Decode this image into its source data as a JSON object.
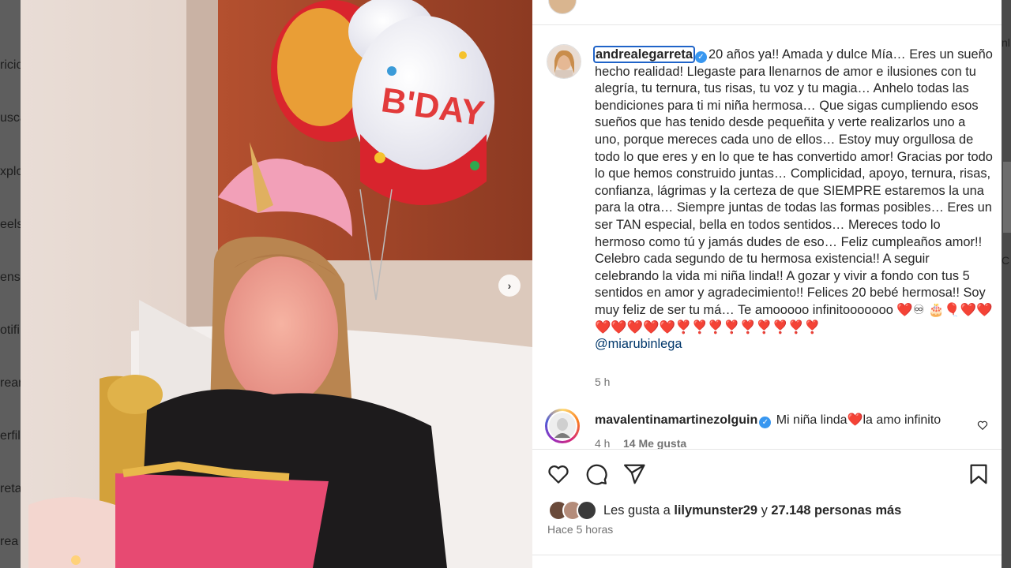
{
  "sidebar": {
    "items": [
      "ricio",
      "usca",
      "xplo",
      "eels",
      "ensa",
      "otifi",
      "rear",
      "erfil",
      "reta",
      "rea"
    ]
  },
  "right_strip": {
    "items": [
      "nl",
      "C"
    ]
  },
  "post": {
    "top_username": "andrealegarreta",
    "author": "andrealegarreta",
    "caption_text": "20 años ya!! Amada y dulce Mía… Eres un sueño hecho realidad! Llegaste para llenarnos de amor e ilusiones con tu alegría, tu ternura, tus risas, tu voz y tu magia… Anhelo todas las bendiciones para ti mi niña hermosa… Que sigas cumpliendo esos sueños que has tenido desde pequeñita y verte realizarlos uno a uno, porque mereces cada uno de ellos… Estoy muy orgullosa de todo lo que eres y en lo que te has convertido amor! Gracias por todo lo que hemos construido juntas… Complicidad, apoyo, ternura, risas, confianza, lágrimas y la certeza de que SIEMPRE estaremos la una para la otra… Siempre juntas de todas las formas posibles… Eres un ser TAN especial, bella en todos sentidos… Mereces todo lo hermoso como tú y jamás dudes de eso… Feliz cumpleaños amor!! Celebro cada segundo de tu hermosa existencia!! A seguir celebrando la vida mi niña linda!! A gozar y vivir a fondo con tus 5 sentidos en amor y agradecimiento!! Felices 20 bebé hermosa!! Soy muy feliz de ser tu má… Te amooooo infinitooooooo ❤️♾ 🎂🎈❤️❤️❤️❤️❤️❤️❤️❣️❣️❣️❣️❣️❣️❣️❣️❣️",
    "mention": "@miarubinlega",
    "time": "5 h",
    "comment": {
      "username": "mavalentinamartinezolguin",
      "text": "Mi niña linda❤️la amo infinito",
      "time": "4 h",
      "likes": "14 Me gusta"
    },
    "likes_prefix": "Les gusta a",
    "likes_user": "lilymunster29",
    "likes_conj": "y",
    "likes_count": "27.148 personas más",
    "posted_ago": "Hace 5 horas"
  },
  "icons": {
    "like": "heart-icon",
    "comment": "comment-icon",
    "share": "send-icon",
    "save": "bookmark-icon",
    "next": "chevron-right-icon",
    "verified": "verified-badge-icon"
  },
  "colors": {
    "verified": "#3897f0",
    "mention": "#00376b",
    "heart": "#e8262f",
    "focus_outline": "#1f63c8"
  }
}
